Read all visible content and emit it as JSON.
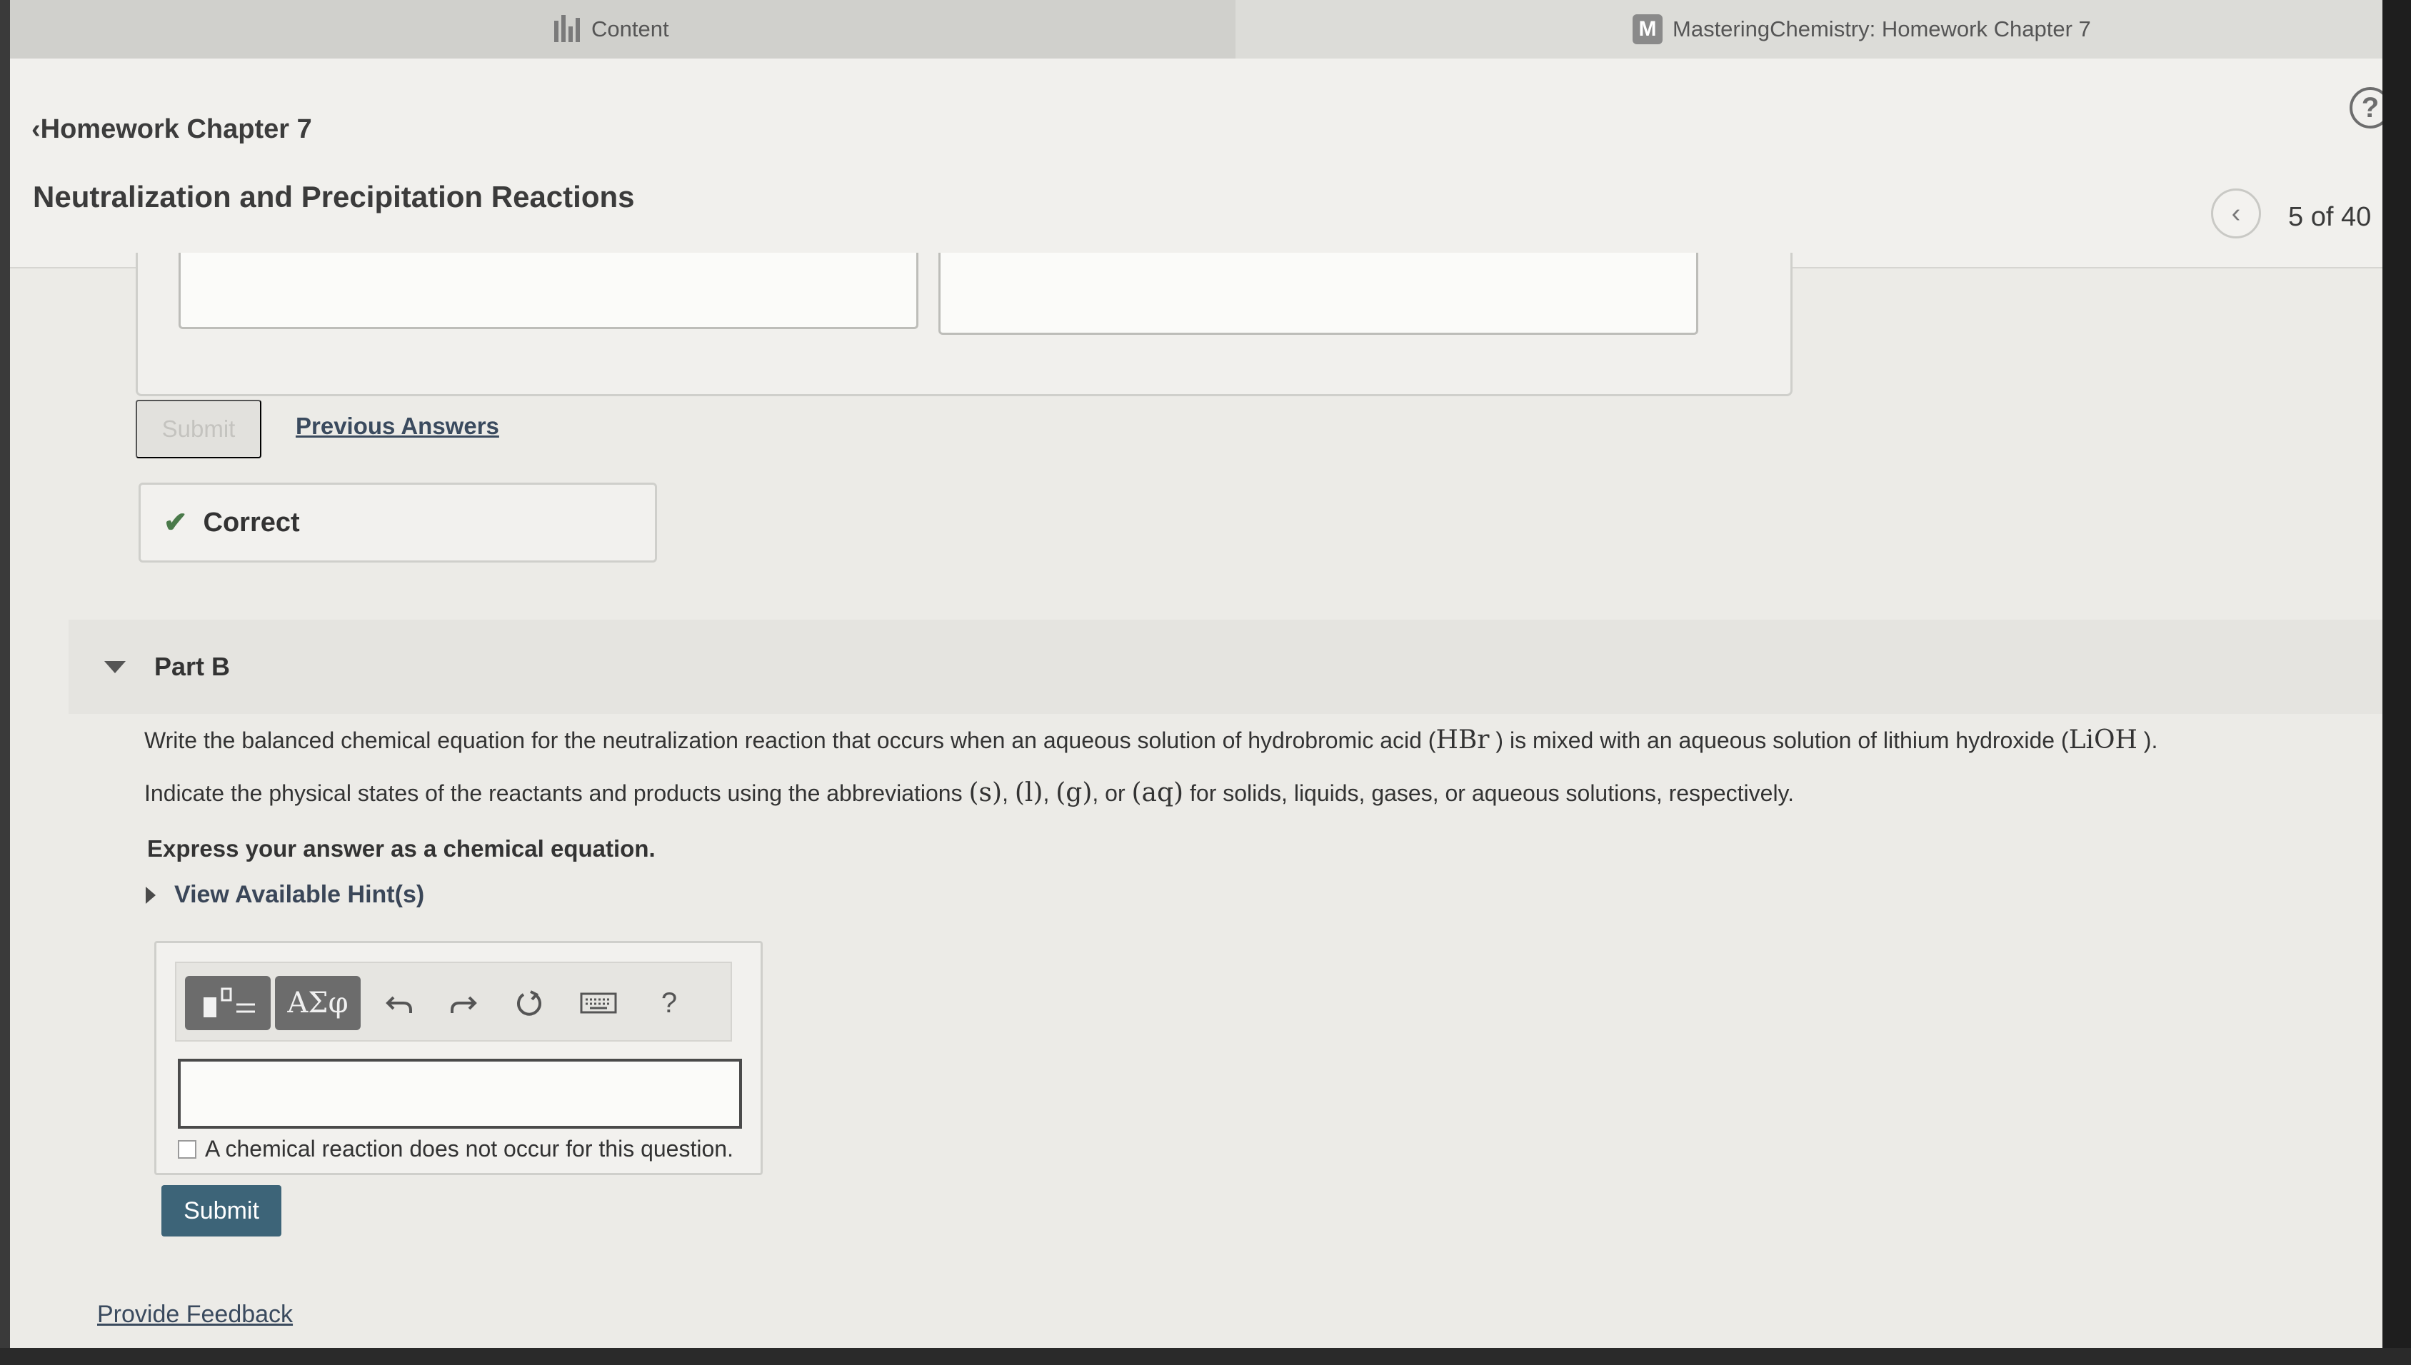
{
  "tabs": [
    {
      "label": "Content",
      "icon": "bar-chart-icon",
      "active": true
    },
    {
      "label": "MasteringChemistry: Homework Chapter 7",
      "icon": "m-logo-icon",
      "active": false
    }
  ],
  "header": {
    "back_label": "Homework Chapter 7",
    "title": "Neutralization and Precipitation Reactions",
    "pager": "5 of 40",
    "help_icon": "?"
  },
  "part_a": {
    "submit_label": "Submit",
    "previous_answers_label": "Previous Answers",
    "feedback_label": "Correct",
    "feedback_icon": "✔"
  },
  "part_b": {
    "label": "Part B",
    "q1_a": "Write the balanced chemical equation for the neutralization reaction that occurs when an aqueous solution of hydrobromic acid (",
    "q1_b": "HBr",
    "q1_c": ") is mixed with an aqueous solution of lithium hydroxide (",
    "q1_d": "LiOH",
    "q1_e": ").",
    "q2_a": "Indicate the physical states of the reactants and products using the abbreviations ",
    "q2_s": "(s)",
    "q2_l": "(l)",
    "q2_g": "(g)",
    "q2_or": ", or ",
    "q2_aq": "(aq)",
    "q2_end": " for solids, liquids, gases, or aqueous solutions, respectively.",
    "sep": ", ",
    "express": "Express your answer as a chemical equation.",
    "hints_label": "View Available Hint(s)",
    "editor": {
      "greek_label": "ΑΣφ",
      "help_label": "?",
      "answer_value": "",
      "no_reaction_label": "A chemical reaction does not occur for this question."
    },
    "submit_label": "Submit"
  },
  "footer": {
    "feedback_link": "Provide Feedback"
  },
  "colors": {
    "submit_button": "#3d6478",
    "correct_check": "#4a7a4a",
    "link": "#3a4a5e"
  }
}
